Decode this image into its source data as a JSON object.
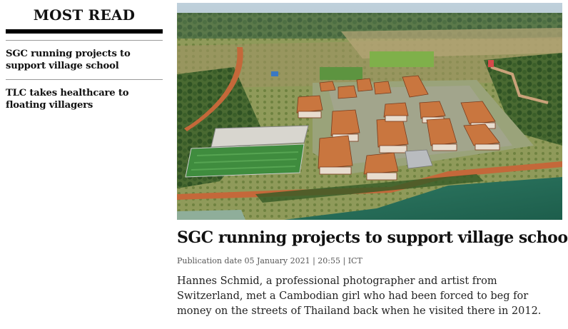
{
  "sidebar": {
    "title": "MOST READ",
    "items": [
      {
        "label": "SGC running projects to support village school"
      },
      {
        "label": "TLC takes healthcare to floating villagers"
      }
    ]
  },
  "article": {
    "headline": "SGC running projects to support village school",
    "meta": "Publication date 05 January 2021 | 20:55 | ICT",
    "excerpt": "Hannes Schmid, a professional photographer and artist from Switzerland, met a Cambodian girl who had been forced to beg for money on the streets of Thailand back when he visited there in 2012."
  }
}
